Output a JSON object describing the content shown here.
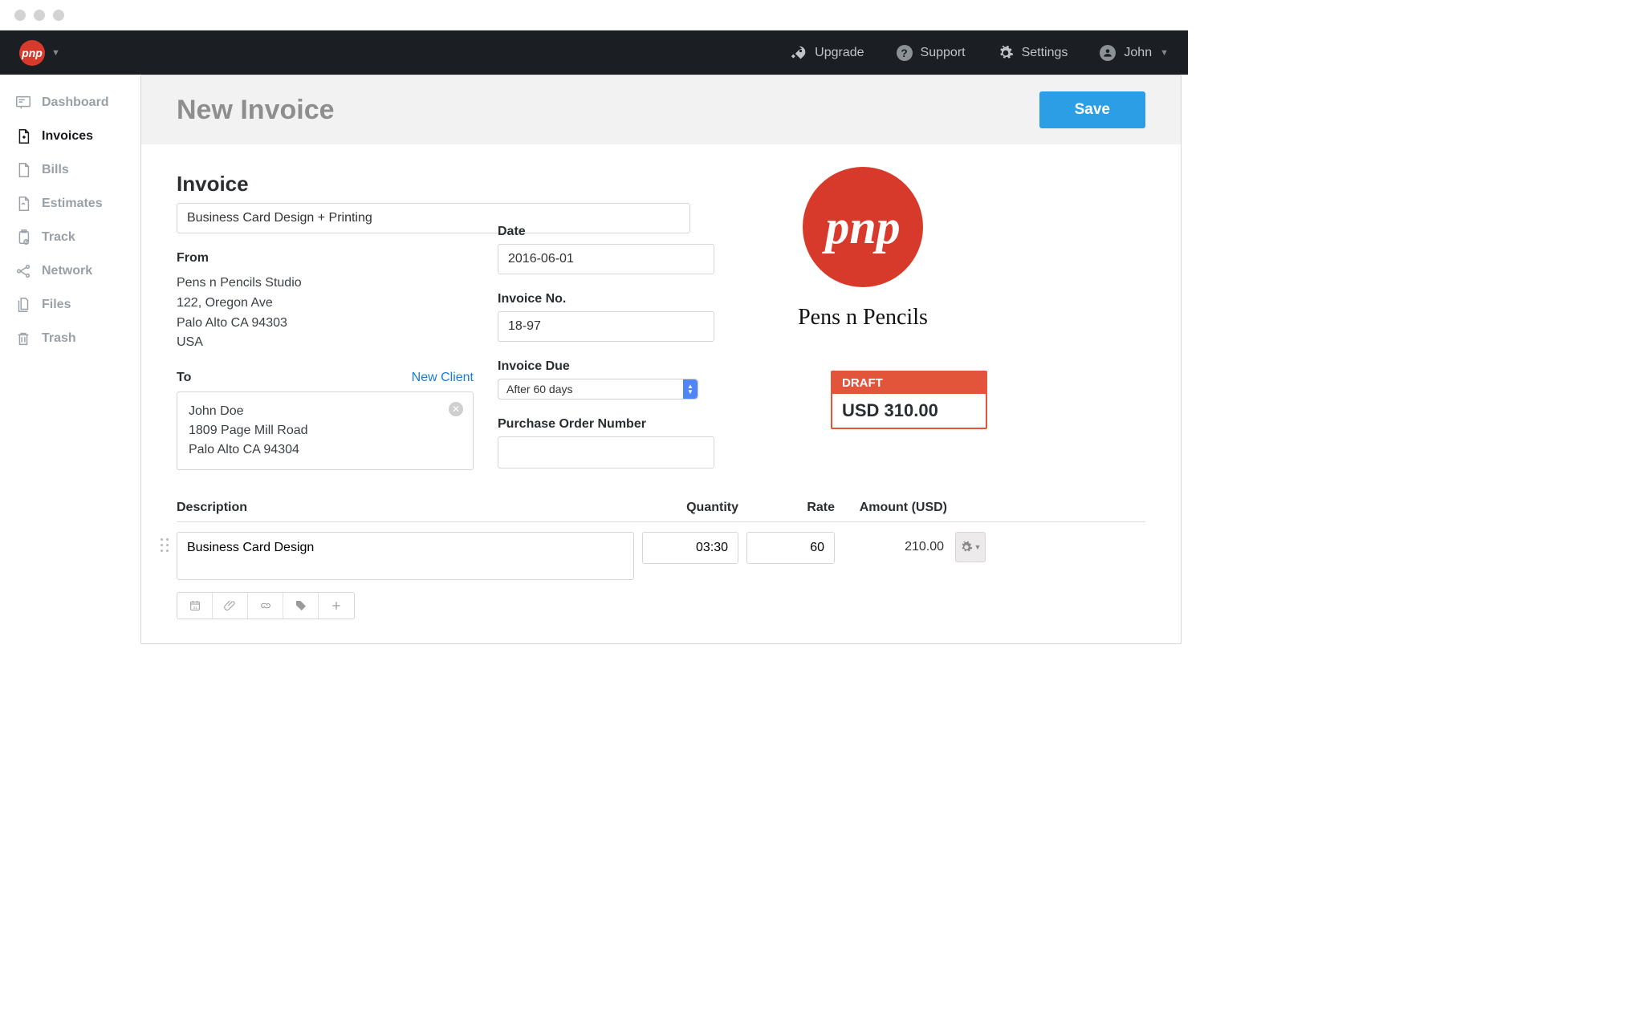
{
  "topnav": {
    "upgrade": "Upgrade",
    "support": "Support",
    "settings": "Settings",
    "user": "John"
  },
  "sidebar": {
    "items": [
      {
        "label": "Dashboard"
      },
      {
        "label": "Invoices"
      },
      {
        "label": "Bills"
      },
      {
        "label": "Estimates"
      },
      {
        "label": "Track"
      },
      {
        "label": "Network"
      },
      {
        "label": "Files"
      },
      {
        "label": "Trash"
      }
    ],
    "active_index": 1
  },
  "header": {
    "title": "New Invoice",
    "save_label": "Save"
  },
  "invoice": {
    "section_title": "Invoice",
    "title_value": "Business Card Design + Printing",
    "from_label": "From",
    "from_name": "Pens n Pencils Studio",
    "from_street": "122, Oregon Ave",
    "from_city": "Palo Alto CA 94303",
    "from_country": "USA",
    "to_label": "To",
    "new_client_label": "New Client",
    "to_name": "John Doe",
    "to_street": "1809 Page Mill Road",
    "to_city": "Palo Alto CA 94304",
    "date_label": "Date",
    "date_value": "2016-06-01",
    "invno_label": "Invoice No.",
    "invno_value": "18-97",
    "due_label": "Invoice Due",
    "due_value": "After 60 days",
    "po_label": "Purchase Order Number",
    "po_value": "",
    "brand_name": "Pens n Pencils",
    "brand_abbrev": "pnp",
    "status_label": "DRAFT",
    "status_amount": "USD 310.00"
  },
  "items": {
    "headers": {
      "description": "Description",
      "quantity": "Quantity",
      "rate": "Rate",
      "amount": "Amount (USD)"
    },
    "rows": [
      {
        "description": "Business Card Design",
        "quantity": "03:30",
        "rate": "60",
        "amount": "210.00"
      }
    ]
  }
}
